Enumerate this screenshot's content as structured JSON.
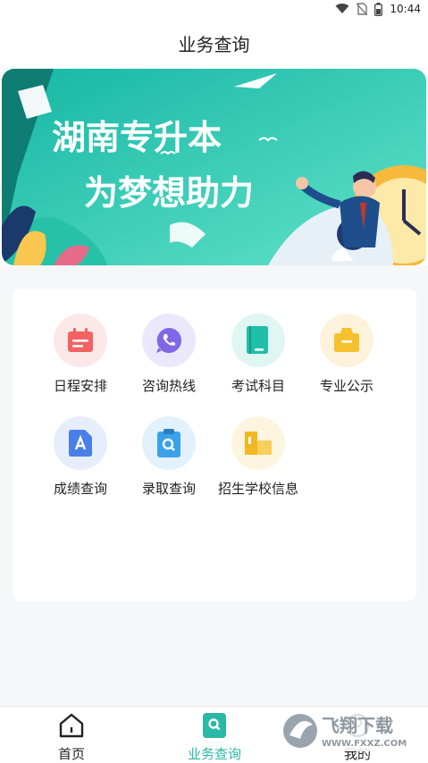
{
  "status_bar": {
    "time": "10:44",
    "icons": [
      "wifi-icon",
      "no-sim-icon",
      "battery-icon"
    ]
  },
  "header": {
    "title": "业务查询"
  },
  "banner": {
    "line1": "湖南专升本",
    "line2": "为梦想助力",
    "colors": {
      "bg_start": "#18c0a8",
      "bg_end": "#5ee0c8",
      "text": "#ffffff"
    }
  },
  "services": [
    {
      "label": "日程安排",
      "icon": "calendar-icon",
      "bg": "#fde8e8",
      "fg": "#f26262"
    },
    {
      "label": "咨询热线",
      "icon": "phone-icon",
      "bg": "#ece8fb",
      "fg": "#7e68e8"
    },
    {
      "label": "考试科目",
      "icon": "book-icon",
      "bg": "#e0f6f2",
      "fg": "#20c0a8"
    },
    {
      "label": "专业公示",
      "icon": "folder-icon",
      "bg": "#fdf3dc",
      "fg": "#f6c12e"
    },
    {
      "label": "成绩查询",
      "icon": "score-document-icon",
      "bg": "#e6eefc",
      "fg": "#4b7fe8"
    },
    {
      "label": "录取查询",
      "icon": "clipboard-search-icon",
      "bg": "#e2f1fb",
      "fg": "#3aa2ea"
    },
    {
      "label": "招生学校信息",
      "icon": "building-icon",
      "bg": "#fdf5df",
      "fg": "#f2b824"
    }
  ],
  "tabbar": {
    "tabs": [
      {
        "label": "首页",
        "icon": "home-icon",
        "active": false
      },
      {
        "label": "业务查询",
        "icon": "search-square-icon",
        "active": true
      },
      {
        "label": "我的",
        "icon": "profile-icon",
        "active": false
      }
    ],
    "active_color": "#2bb8a6",
    "inactive_color": "#222222"
  },
  "watermark": {
    "title": "飞翔下载",
    "url": "WWW.FXXZ.COM"
  }
}
